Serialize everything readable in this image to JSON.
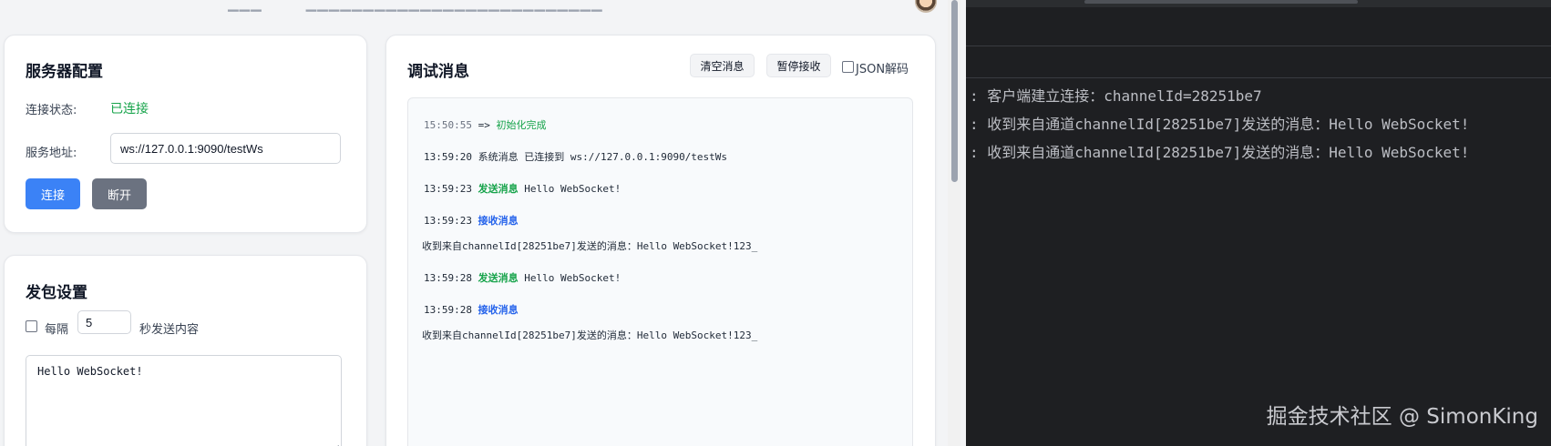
{
  "server_config": {
    "title": "服务器配置",
    "status_label": "连接状态:",
    "status_value": "已连接",
    "address_label": "服务地址:",
    "address_value": "ws://127.0.0.1:9090/testWs",
    "connect_button": "连接",
    "disconnect_button": "断开"
  },
  "packet_settings": {
    "title": "发包设置",
    "interval_prefix": "每隔",
    "interval_value": "5",
    "interval_suffix": "秒发送内容",
    "content": "Hello WebSocket!"
  },
  "debug": {
    "title": "调试消息",
    "clear_button": "清空消息",
    "pause_button": "暂停接收",
    "json_decode_label": "JSON解码",
    "messages": [
      {
        "time": "15:50:55",
        "type": "=>",
        "text": "初始化完成"
      },
      {
        "time": "13:59:20",
        "type": "系统消息",
        "text": "已连接到 ws://127.0.0.1:9090/testWs"
      },
      {
        "time": "13:59:23",
        "type": "发送消息",
        "text": "Hello WebSocket!"
      },
      {
        "time": "13:59:23",
        "type": "接收消息",
        "text": "收到来自channelId[28251be7]发送的消息：Hello WebSocket!123_"
      },
      {
        "time": "13:59:28",
        "type": "发送消息",
        "text": "Hello WebSocket!"
      },
      {
        "time": "13:59:28",
        "type": "接收消息",
        "text": "收到来自channelId[28251be7]发送的消息：Hello WebSocket!123_"
      }
    ]
  },
  "terminal": {
    "lines": [
      ": 客户端建立连接：channelId=28251be7",
      ": 收到来自通道channelId[28251be7]发送的消息：Hello WebSocket!",
      ": 收到来自通道channelId[28251be7]发送的消息：Hello WebSocket!"
    ],
    "watermark": "掘金技术社区 @ SimonKing"
  },
  "colors": {
    "primary": "#3b82f6",
    "secondary": "#6b7280",
    "success": "#16a34a",
    "receive": "#2563eb",
    "terminal_bg": "#1e1f22"
  }
}
